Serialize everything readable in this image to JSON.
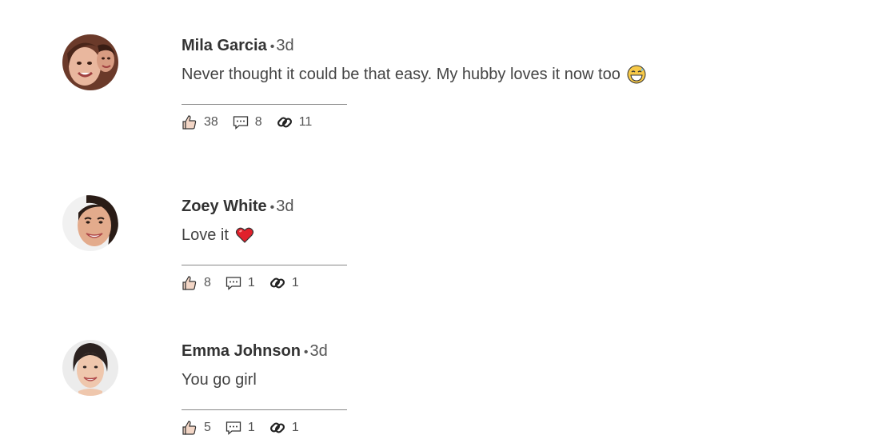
{
  "comments": [
    {
      "author": "Mila Garcia",
      "separator": "•",
      "time": "3d",
      "text": "Never thought it could be that easy. My hubby loves it now too",
      "emoji": "grinning-sweat-emoji",
      "likes": "38",
      "replies": "8",
      "shares": "11"
    },
    {
      "author": "Zoey White",
      "separator": "•",
      "time": "3d",
      "text": "Love it",
      "emoji": "red-heart-emoji",
      "likes": "8",
      "replies": "1",
      "shares": "1"
    },
    {
      "author": "Emma Johnson",
      "separator": "•",
      "time": "3d",
      "text": "You go girl",
      "emoji": "",
      "likes": "5",
      "replies": "1",
      "shares": "1"
    }
  ],
  "icons": {
    "like": "thumbs-up-icon",
    "reply": "speech-bubble-icon",
    "share": "link-icon"
  },
  "colors": {
    "author": "#333333",
    "text": "#444444",
    "meta": "#555555",
    "divider": "#888888",
    "heart": "#e0202b"
  }
}
